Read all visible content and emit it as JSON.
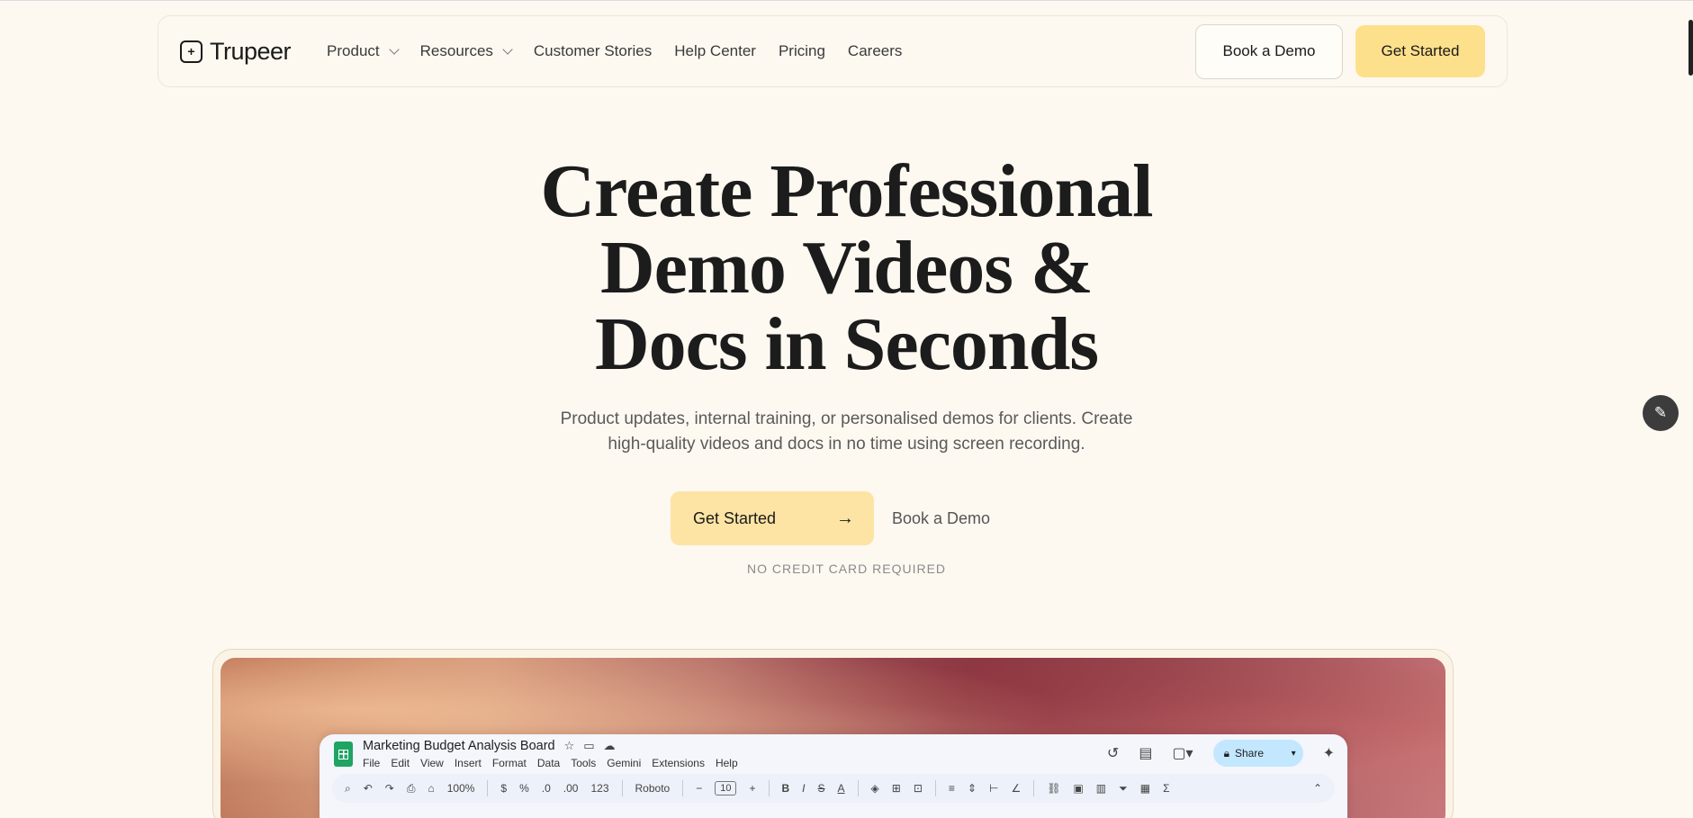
{
  "nav": {
    "logo_text": "Trupeer",
    "links": {
      "product": "Product",
      "resources": "Resources",
      "customer_stories": "Customer Stories",
      "help_center": "Help Center",
      "pricing": "Pricing",
      "careers": "Careers"
    },
    "book_demo": "Book a Demo",
    "get_started": "Get Started"
  },
  "hero": {
    "title_line1": "Create Professional",
    "title_line2": "Demo Videos &",
    "title_line3": "Docs in Seconds",
    "subtitle_line1": "Product updates, internal training, or personalised demos for clients. Create",
    "subtitle_line2": "high-quality videos and docs in no time using screen recording.",
    "cta_primary": "Get Started",
    "cta_secondary": "Book a Demo",
    "note": "NO CREDIT CARD REQUIRED"
  },
  "sheet": {
    "title": "Marketing Budget Analysis Board",
    "menu": [
      "File",
      "Edit",
      "View",
      "Insert",
      "Format",
      "Data",
      "Tools",
      "Gemini",
      "Extensions",
      "Help"
    ],
    "share_label": "Share",
    "toolbar": {
      "zoom": "100%",
      "currency": "$",
      "percent": "%",
      "dec_less": ".0",
      "dec_more": ".00",
      "number_format": "123",
      "font": "Roboto",
      "font_size": "10",
      "bold": "B",
      "italic": "I",
      "strike": "S",
      "text_color": "A",
      "sum": "Σ"
    }
  },
  "colors": {
    "background": "#fdf9f1",
    "accent_yellow": "#fde08b",
    "sheet_green": "#1fa463",
    "share_blue": "#c2e7ff"
  },
  "icons": {
    "logo": "trupeer-logo-icon",
    "edit_fab": "pencil-icon",
    "cta_arrow": "arrow-right-icon"
  }
}
